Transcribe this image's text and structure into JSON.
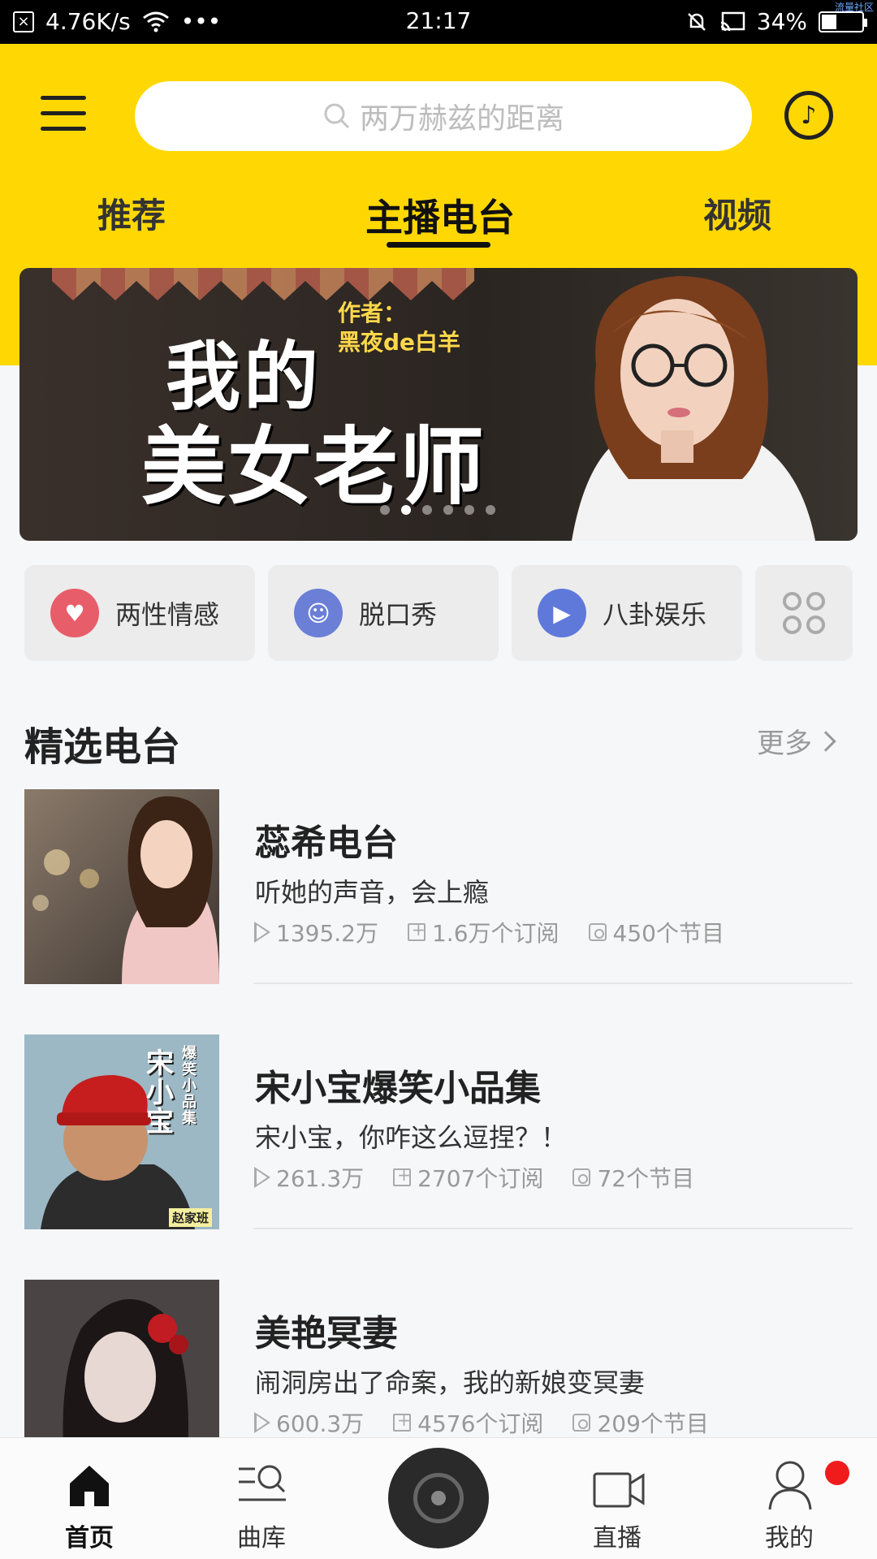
{
  "status_bar": {
    "speed": "4.76K/s",
    "time": "21:17",
    "battery": "34%",
    "corner_text": "流量社区"
  },
  "header": {
    "search_placeholder": "两万赫兹的距离",
    "tabs": [
      {
        "label": "推荐",
        "active": false
      },
      {
        "label": "主播电台",
        "active": true
      },
      {
        "label": "视频",
        "active": false
      }
    ]
  },
  "banner": {
    "author_label": "作者：",
    "author_name": "黑夜de白羊",
    "title_line1": "我的",
    "title_line2": "美女老师",
    "dot_count": 6,
    "active_dot": 2
  },
  "categories": [
    {
      "label": "两性情感",
      "icon": "heart-icon",
      "color": "#e85d6a"
    },
    {
      "label": "脱口秀",
      "icon": "smile-icon",
      "color": "#6b7fd7"
    },
    {
      "label": "八卦娱乐",
      "icon": "play-icon",
      "color": "#5f79db"
    },
    {
      "label": "",
      "icon": "grid-icon",
      "color": "#aaaaaa"
    }
  ],
  "section": {
    "title": "精选电台",
    "more_label": "更多"
  },
  "radios": [
    {
      "name": "蕊希电台",
      "desc": "听她的声音，会上瘾",
      "plays": "1395.2万",
      "subs": "1.6万个订阅",
      "episodes": "450个节目"
    },
    {
      "name": "宋小宝爆笑小品集",
      "desc": "宋小宝，你咋这么逗捏？！",
      "plays": "261.3万",
      "subs": "2707个订阅",
      "episodes": "72个节目",
      "thumb_text": "宋小宝",
      "thumb_sub": "爆笑小品集",
      "thumb_tag": "赵家班"
    },
    {
      "name": "美艳冥妻",
      "desc": "闹洞房出了命案，我的新娘变冥妻",
      "plays": "600.3万",
      "subs": "4576个订阅",
      "episodes": "209个节目",
      "thumb_text": "美艳冥妻"
    }
  ],
  "bottom_nav": [
    {
      "label": "首页",
      "icon": "home-icon",
      "active": true
    },
    {
      "label": "曲库",
      "icon": "library-icon",
      "active": false
    },
    {
      "label": "",
      "icon": "disc-icon",
      "active": false
    },
    {
      "label": "直播",
      "icon": "video-camera-icon",
      "active": false
    },
    {
      "label": "我的",
      "icon": "person-icon",
      "active": false,
      "badge": true
    }
  ],
  "colors": {
    "accent_yellow": "#ffd803",
    "badge_red": "#f01c1c"
  }
}
